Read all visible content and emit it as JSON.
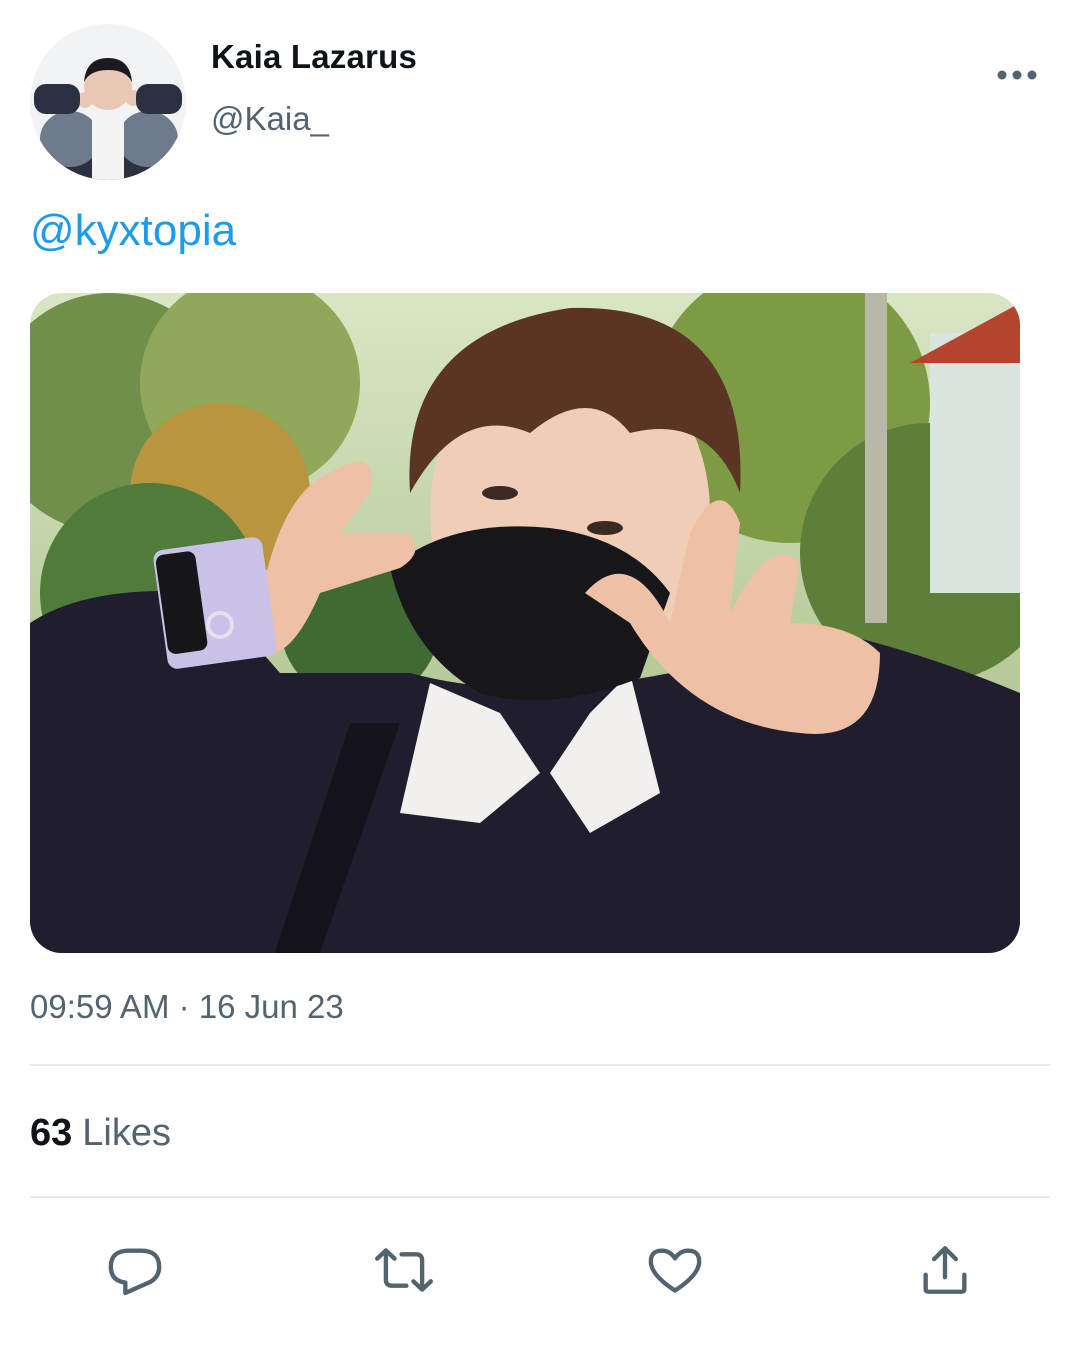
{
  "author": {
    "display_name": "Kaia Lazarus",
    "handle": "@Kaia_"
  },
  "tweet": {
    "text": "@kyxtopia",
    "timestamp": "09:59 AM · 16 Jun 23",
    "likes_count": "63",
    "likes_label": "Likes"
  },
  "icons": {
    "more": "more-horizontal-icon",
    "reply": "reply-icon",
    "retweet": "retweet-icon",
    "like": "heart-icon",
    "share": "share-icon"
  },
  "colors": {
    "link": "#1d9bf0",
    "secondary_text": "#536471",
    "primary_text": "#0f1419",
    "divider": "#e7eaec"
  }
}
